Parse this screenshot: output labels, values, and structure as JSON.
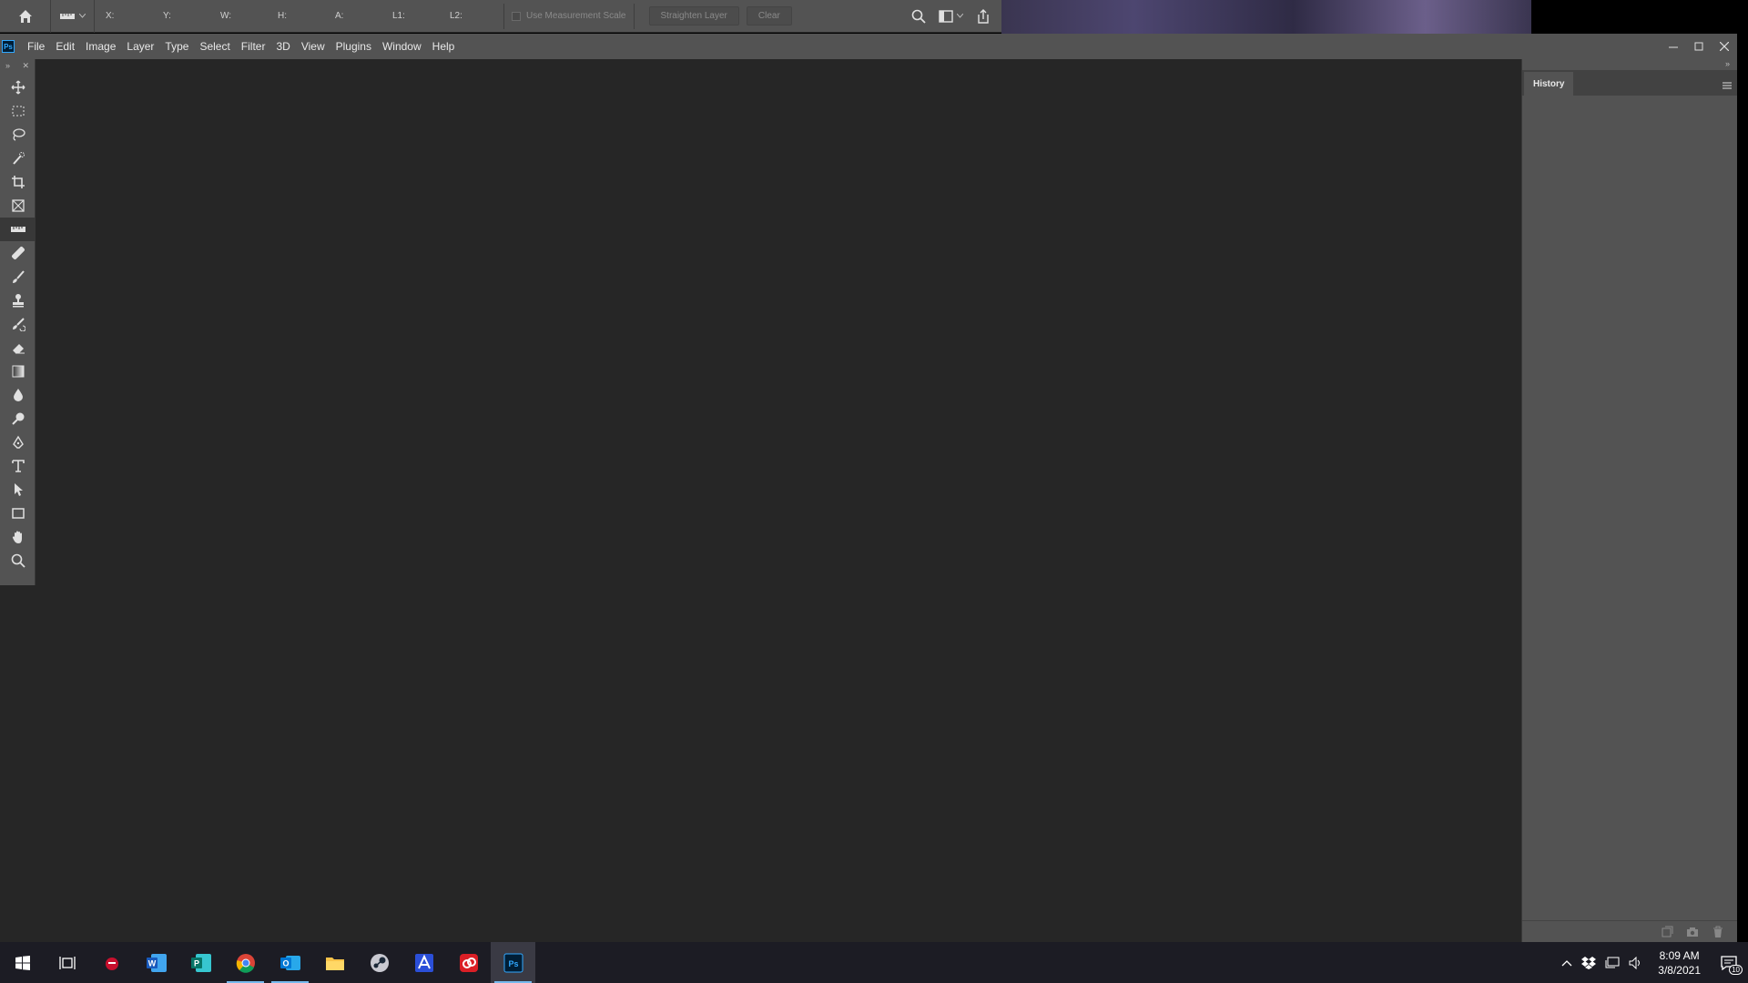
{
  "options_bar": {
    "tool_icon": "ruler-icon",
    "fields": [
      "X:",
      "Y:",
      "W:",
      "H:",
      "A:",
      "L1:",
      "L2:"
    ],
    "use_measurement_scale_label": "Use Measurement Scale",
    "straighten_layer_label": "Straighten Layer",
    "clear_label": "Clear"
  },
  "menu": {
    "app_logo": "Ps",
    "items": [
      "File",
      "Edit",
      "Image",
      "Layer",
      "Type",
      "Select",
      "Filter",
      "3D",
      "View",
      "Plugins",
      "Window",
      "Help"
    ]
  },
  "toolbar": {
    "tools": [
      {
        "name": "move-tool",
        "icon": "move-icon"
      },
      {
        "name": "rectangular-marquee-tool",
        "icon": "marquee-icon"
      },
      {
        "name": "lasso-tool",
        "icon": "lasso-icon"
      },
      {
        "name": "quick-selection-tool",
        "icon": "quick-selection-icon"
      },
      {
        "name": "crop-tool",
        "icon": "crop-icon"
      },
      {
        "name": "frame-tool",
        "icon": "frame-icon"
      },
      {
        "name": "ruler-tool",
        "icon": "ruler-icon",
        "active": true
      },
      {
        "name": "healing-brush-tool",
        "icon": "bandage-icon"
      },
      {
        "name": "brush-tool",
        "icon": "brush-icon"
      },
      {
        "name": "clone-stamp-tool",
        "icon": "stamp-icon"
      },
      {
        "name": "history-brush-tool",
        "icon": "history-brush-icon"
      },
      {
        "name": "eraser-tool",
        "icon": "eraser-icon"
      },
      {
        "name": "gradient-tool",
        "icon": "gradient-icon"
      },
      {
        "name": "blur-tool",
        "icon": "drop-icon"
      },
      {
        "name": "dodge-tool",
        "icon": "dodge-icon"
      },
      {
        "name": "pen-tool",
        "icon": "pen-icon"
      },
      {
        "name": "type-tool",
        "icon": "type-icon"
      },
      {
        "name": "path-selection-tool",
        "icon": "arrow-icon"
      },
      {
        "name": "rectangle-tool",
        "icon": "rectangle-icon"
      },
      {
        "name": "hand-tool",
        "icon": "hand-icon"
      },
      {
        "name": "zoom-tool",
        "icon": "zoom-icon"
      }
    ]
  },
  "history_panel": {
    "tab_label": "History"
  },
  "taskbar": {
    "time": "8:09 AM",
    "date": "3/8/2021",
    "notification_count": "10",
    "apps": [
      {
        "name": "start",
        "icon": "windows-icon"
      },
      {
        "name": "task-view",
        "icon": "task-view-icon"
      },
      {
        "name": "app-red",
        "icon": "red-app-icon"
      },
      {
        "name": "word",
        "icon": "word-icon",
        "label": "W"
      },
      {
        "name": "publisher",
        "icon": "publisher-icon",
        "label": "P"
      },
      {
        "name": "chrome",
        "icon": "chrome-icon",
        "running": true
      },
      {
        "name": "outlook",
        "icon": "outlook-icon",
        "label": "O",
        "running": true
      },
      {
        "name": "file-explorer",
        "icon": "folder-icon"
      },
      {
        "name": "steam",
        "icon": "steam-icon"
      },
      {
        "name": "app-blue",
        "icon": "blue-app-icon"
      },
      {
        "name": "creative-cloud",
        "icon": "creative-cloud-icon"
      },
      {
        "name": "photoshop",
        "icon": "photoshop-icon",
        "label": "Ps",
        "running": true,
        "active": true
      }
    ]
  }
}
